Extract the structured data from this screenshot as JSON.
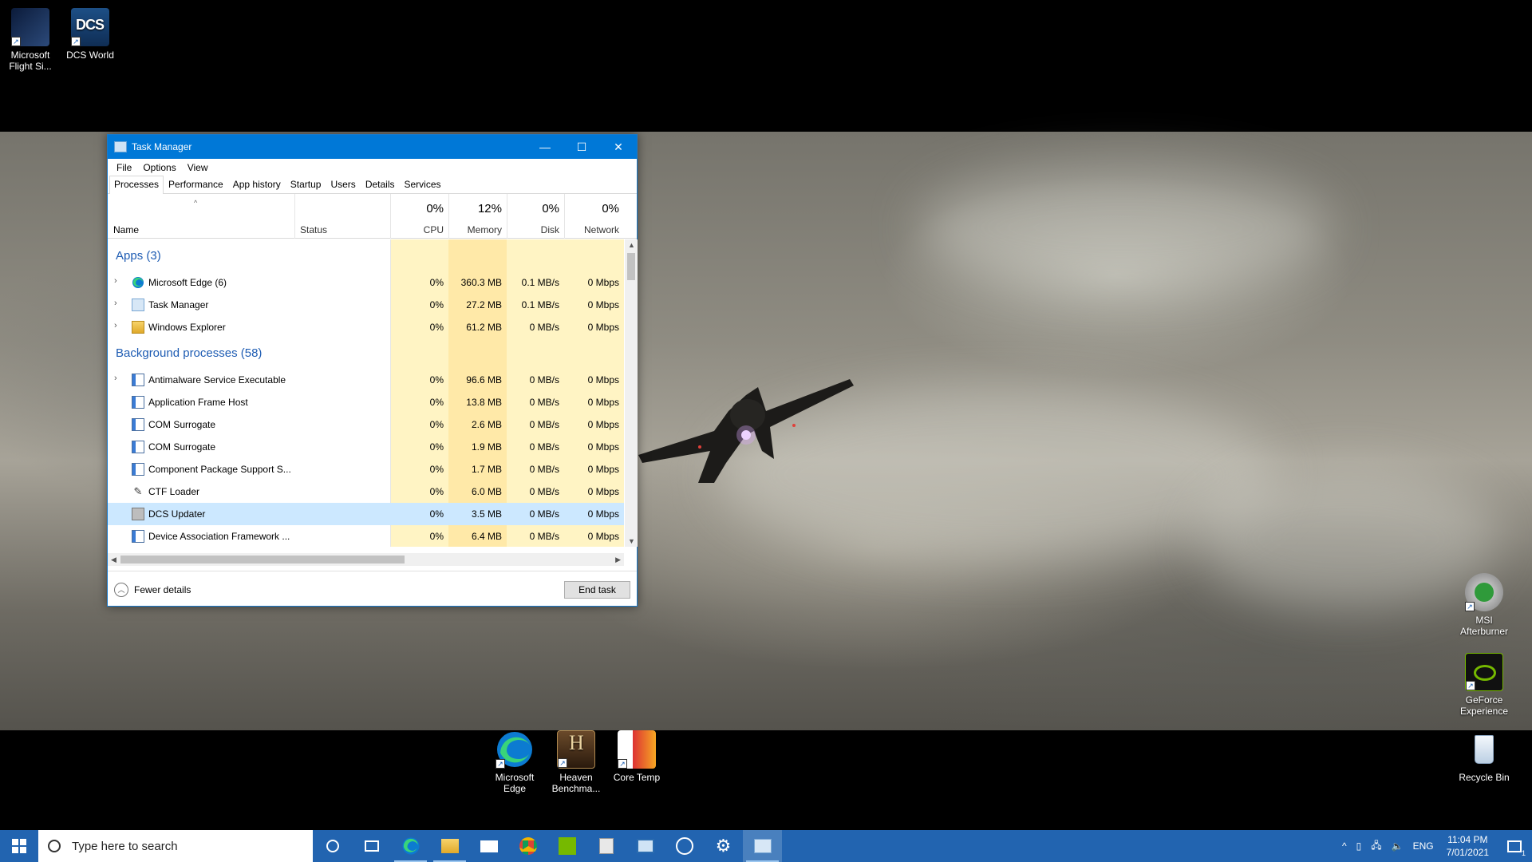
{
  "desktop_icons": {
    "msfs": "Microsoft Flight Si...",
    "dcs": "DCS World",
    "edge": "Microsoft Edge",
    "heaven": "Heaven Benchma...",
    "coretemp": "Core Temp",
    "msi": "MSI Afterburner",
    "geforce": "GeForce Experience",
    "recycle": "Recycle Bin"
  },
  "window": {
    "title": "Task Manager",
    "minimize": "—",
    "maximize": "☐",
    "close": "✕"
  },
  "menu": {
    "file": "File",
    "options": "Options",
    "view": "View"
  },
  "tabs": [
    "Processes",
    "Performance",
    "App history",
    "Startup",
    "Users",
    "Details",
    "Services"
  ],
  "columns": {
    "name": "Name",
    "status": "Status",
    "cpu": {
      "pct": "0%",
      "label": "CPU"
    },
    "memory": {
      "pct": "12%",
      "label": "Memory"
    },
    "disk": {
      "pct": "0%",
      "label": "Disk"
    },
    "network": {
      "pct": "0%",
      "label": "Network"
    }
  },
  "groups": {
    "apps": "Apps (3)",
    "background": "Background processes (58)"
  },
  "apps": [
    {
      "name": "Microsoft Edge (6)",
      "cpu": "0%",
      "memory": "360.3 MB",
      "disk": "0.1 MB/s",
      "network": "0 Mbps",
      "icon": "edge-icon"
    },
    {
      "name": "Task Manager",
      "cpu": "0%",
      "memory": "27.2 MB",
      "disk": "0.1 MB/s",
      "network": "0 Mbps",
      "icon": "task-manager-icon"
    },
    {
      "name": "Windows Explorer",
      "cpu": "0%",
      "memory": "61.2 MB",
      "disk": "0 MB/s",
      "network": "0 Mbps",
      "icon": "folder-icon"
    }
  ],
  "background": [
    {
      "name": "Antimalware Service Executable",
      "cpu": "0%",
      "memory": "96.6 MB",
      "disk": "0 MB/s",
      "network": "0 Mbps"
    },
    {
      "name": "Application Frame Host",
      "cpu": "0%",
      "memory": "13.8 MB",
      "disk": "0 MB/s",
      "network": "0 Mbps"
    },
    {
      "name": "COM Surrogate",
      "cpu": "0%",
      "memory": "2.6 MB",
      "disk": "0 MB/s",
      "network": "0 Mbps"
    },
    {
      "name": "COM Surrogate",
      "cpu": "0%",
      "memory": "1.9 MB",
      "disk": "0 MB/s",
      "network": "0 Mbps"
    },
    {
      "name": "Component Package Support S...",
      "cpu": "0%",
      "memory": "1.7 MB",
      "disk": "0 MB/s",
      "network": "0 Mbps"
    },
    {
      "name": "CTF Loader",
      "cpu": "0%",
      "memory": "6.0 MB",
      "disk": "0 MB/s",
      "network": "0 Mbps"
    },
    {
      "name": "DCS Updater",
      "cpu": "0%",
      "memory": "3.5 MB",
      "disk": "0 MB/s",
      "network": "0 Mbps"
    },
    {
      "name": "Device Association Framework ...",
      "cpu": "0%",
      "memory": "6.4 MB",
      "disk": "0 MB/s",
      "network": "0 Mbps"
    }
  ],
  "footer": {
    "fewer": "Fewer details",
    "end_task": "End task"
  },
  "taskbar": {
    "search_placeholder": "Type here to search",
    "lang": "ENG",
    "time": "11:04 PM",
    "date": "7/01/2021",
    "notif_count": "1"
  }
}
